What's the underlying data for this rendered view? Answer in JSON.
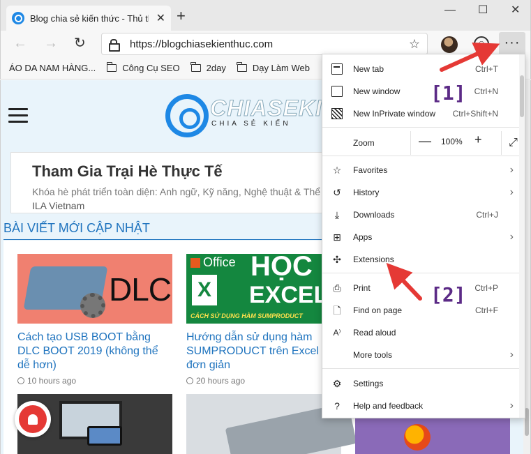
{
  "browser": {
    "tab_title": "Blog chia sẻ kiến thức - Thủ thuật",
    "tab_close": "✕",
    "new_tab_glyph": "+",
    "window_controls": {
      "minimize": "—",
      "maximize": "☐",
      "close": "✕"
    },
    "url": "https://blogchiasekienthuc.com",
    "more_glyph": "···"
  },
  "bookmarks": [
    {
      "label": "ÁO DA NAM HÀNG...",
      "icon": "page-icon"
    },
    {
      "label": "Công Cụ SEO",
      "icon": "folder-icon"
    },
    {
      "label": "2day",
      "icon": "folder-icon"
    },
    {
      "label": "Dạy Làm Web",
      "icon": "folder-icon"
    }
  ],
  "site": {
    "logo_text": "CHIASEKIEN",
    "logo_tagline": "CHIA SẺ KIẾN",
    "ad": {
      "title": "Tham Gia Trại Hè Thực Tế",
      "desc": "Khóa hè phát triển toàn diện: Anh ngữ, Kỹ năng, Nghệ thuật & Thể ch",
      "brand": "ILA Vietnam"
    },
    "section_title": "BÀI VIẾT MỚI CẬP NHẬT",
    "posts": [
      {
        "title": "Cách tạo USB BOOT bằng DLC BOOT 2019 (không thể dễ hơn)",
        "time": "10 hours ago",
        "thumb_text": "DLC"
      },
      {
        "title": "Hướng dẫn sử dụng hàm SUMPRODUCT trên Excel đơn giản",
        "time": "20 hours ago",
        "thumb_office": "Office",
        "thumb_x": "X",
        "thumb_hoc": "HỌC",
        "thumb_excel": "EXCEL",
        "thumb_caption": "CÁCH SỬ DỤNG HÀM SUMPRODUCT"
      }
    ]
  },
  "menu": {
    "items": [
      {
        "label": "New tab",
        "shortcut": "Ctrl+T",
        "icon": "new-tab-icon"
      },
      {
        "label": "New window",
        "shortcut": "Ctrl+N",
        "icon": "new-window-icon"
      },
      {
        "label": "New InPrivate window",
        "shortcut": "Ctrl+Shift+N",
        "icon": "inprivate-icon"
      },
      {
        "label": "Favorites",
        "icon": "star-icon"
      },
      {
        "label": "History",
        "icon": "history-icon"
      },
      {
        "label": "Downloads",
        "shortcut": "Ctrl+J",
        "icon": "download-icon"
      },
      {
        "label": "Apps",
        "icon": "apps-icon"
      },
      {
        "label": "Extensions",
        "icon": "extensions-icon"
      },
      {
        "label": "Print",
        "shortcut": "Ctrl+P",
        "icon": "print-icon"
      },
      {
        "label": "Find on page",
        "shortcut": "Ctrl+F",
        "icon": "find-icon"
      },
      {
        "label": "Read aloud",
        "icon": "read-aloud-icon"
      },
      {
        "label": "More tools",
        "icon": ""
      },
      {
        "label": "Settings",
        "icon": "gear-icon"
      },
      {
        "label": "Help and feedback",
        "icon": "help-icon"
      }
    ],
    "zoom": {
      "label": "Zoom",
      "value": "100%",
      "minus": "—",
      "plus": "+"
    }
  },
  "annotations": {
    "one": "[1]",
    "two": "[2]"
  },
  "colors": {
    "accent": "#1e73be",
    "annotation": "#5b2a86",
    "arrow": "#e53935"
  }
}
